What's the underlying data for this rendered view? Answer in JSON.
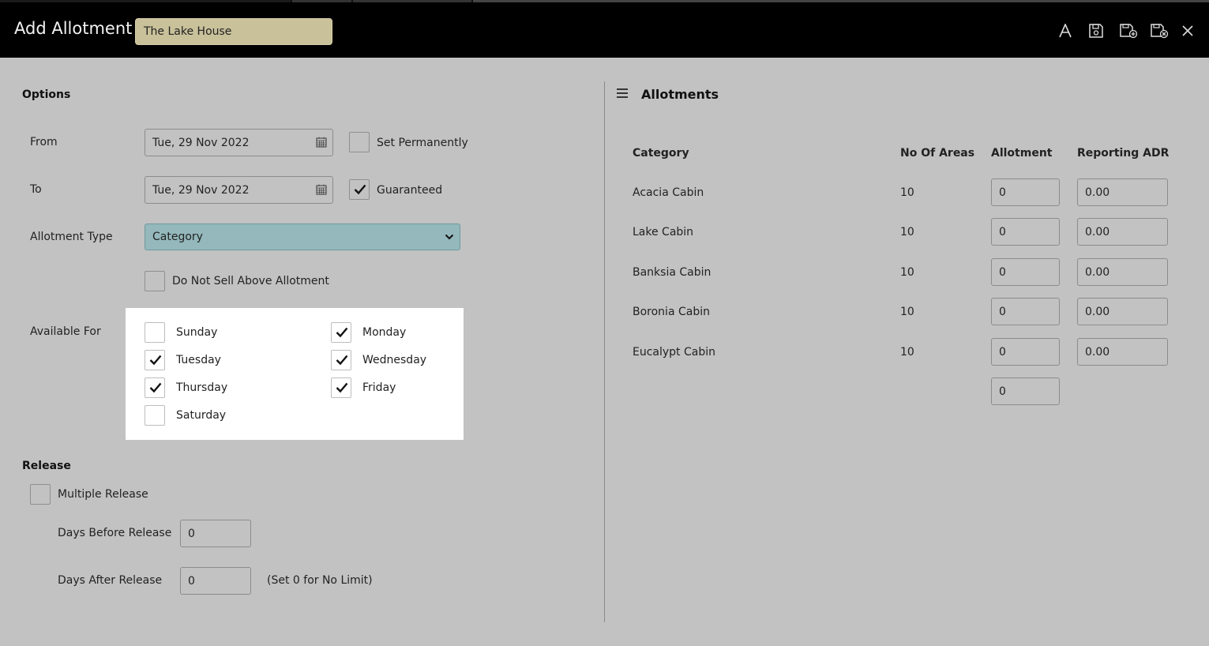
{
  "header": {
    "title": "Add Allotment",
    "property_value": "The Lake House",
    "icons": [
      "font-icon",
      "save-icon",
      "save-add-icon",
      "save-close-icon",
      "close-icon"
    ]
  },
  "options": {
    "section_title": "Options",
    "from_label": "From",
    "from_value": "Tue, 29 Nov 2022",
    "to_label": "To",
    "to_value": "Tue, 29 Nov 2022",
    "set_permanently_label": "Set Permanently",
    "set_permanently_checked": false,
    "guaranteed_label": "Guaranteed",
    "guaranteed_checked": true,
    "allotment_type_label": "Allotment Type",
    "allotment_type_value": "Category",
    "do_not_sell_label": "Do Not Sell Above Allotment",
    "do_not_sell_checked": false,
    "available_for_label": "Available For",
    "days": [
      {
        "label": "Sunday",
        "checked": false
      },
      {
        "label": "Monday",
        "checked": true
      },
      {
        "label": "Tuesday",
        "checked": true
      },
      {
        "label": "Wednesday",
        "checked": true
      },
      {
        "label": "Thursday",
        "checked": true
      },
      {
        "label": "Friday",
        "checked": true
      },
      {
        "label": "Saturday",
        "checked": false
      }
    ]
  },
  "release": {
    "section_title": "Release",
    "multiple_release_label": "Multiple Release",
    "multiple_release_checked": false,
    "days_before_label": "Days Before Release",
    "days_before_value": "0",
    "days_after_label": "Days After Release",
    "days_after_value": "0",
    "hint": "(Set 0 for No Limit)"
  },
  "allotments": {
    "title": "Allotments",
    "columns": [
      "Category",
      "No Of Areas",
      "Allotment",
      "Reporting ADR"
    ],
    "rows": [
      {
        "category": "Acacia Cabin",
        "areas": "10",
        "allotment": "0",
        "adr": "0.00"
      },
      {
        "category": "Lake Cabin",
        "areas": "10",
        "allotment": "0",
        "adr": "0.00"
      },
      {
        "category": "Banksia Cabin",
        "areas": "10",
        "allotment": "0",
        "adr": "0.00"
      },
      {
        "category": "Boronia Cabin",
        "areas": "10",
        "allotment": "0",
        "adr": "0.00"
      },
      {
        "category": "Eucalypt Cabin",
        "areas": "10",
        "allotment": "0",
        "adr": "0.00"
      }
    ],
    "total_allotment": "0"
  },
  "colors": {
    "header_bg": "#000000",
    "body_bg": "#c2c2c2",
    "property_field": "#c9c19a",
    "select_bg": "#94b8bb"
  }
}
